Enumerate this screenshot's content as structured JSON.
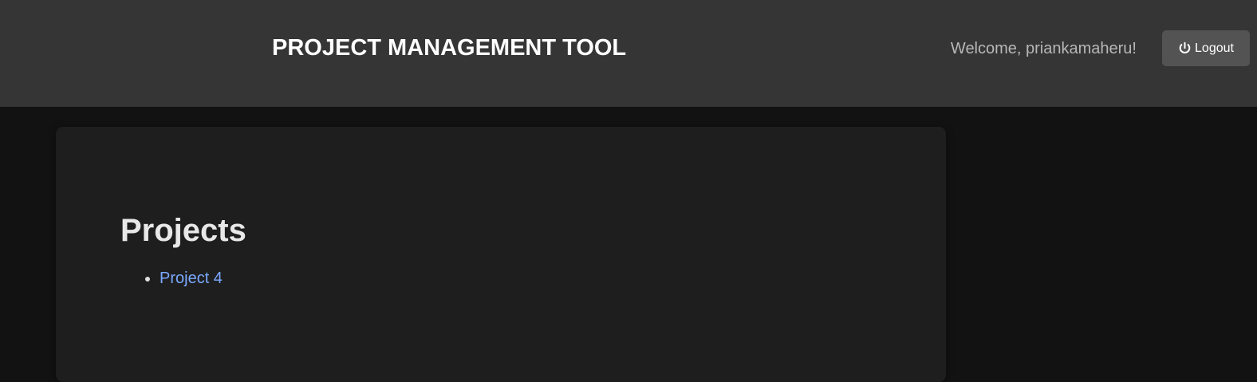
{
  "header": {
    "title": "PROJECT MANAGEMENT TOOL",
    "welcome": "Welcome, priankamaheru!",
    "logout_label": "Logout",
    "logout_icon": "power-icon"
  },
  "main": {
    "heading": "Projects",
    "projects": [
      {
        "label": "Project 4"
      }
    ]
  },
  "colors": {
    "page_background": "#121212",
    "header_background": "#353535",
    "card_background": "#1e1e1e",
    "button_background": "#535353",
    "link": "#7aa9ff"
  }
}
